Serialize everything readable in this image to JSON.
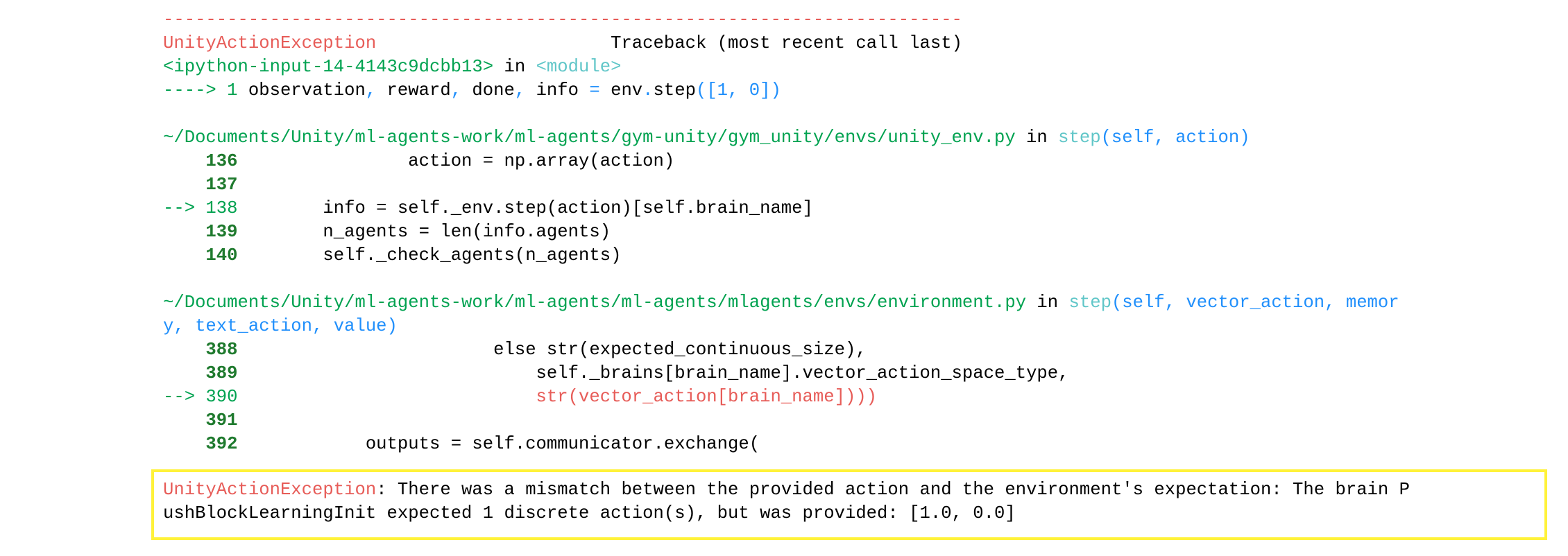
{
  "traceback": {
    "separator": "---------------------------------------------------------------------------",
    "exception_name": "UnityActionException",
    "header_gap": "                      ",
    "header_right": "Traceback (most recent call last)",
    "frame1": {
      "location": "<ipython-input-14-4143c9dcbb13>",
      "in_word": " in ",
      "module": "<module>",
      "arrow": "----> 1",
      "code_a": " observation",
      "comma1": ",",
      "code_b": " reward",
      "comma2": ",",
      "code_c": " done",
      "comma3": ",",
      "code_d": " info ",
      "eq": "=",
      "code_e": " env",
      "dot": ".",
      "code_f": "step",
      "args": "([1, 0])"
    },
    "frame2": {
      "path": "~/Documents/Unity/ml-agents-work/ml-agents/gym-unity/gym_unity/envs/unity_env.py",
      "in_word": " in ",
      "func": "step",
      "signature": "(self, action)",
      "lines": [
        {
          "num": "    136",
          "code": "                action = np.array(action)"
        },
        {
          "num": "    137",
          "code": ""
        },
        {
          "num": "--> 138",
          "code": "        info = self._env.step(action)[self.brain_name]"
        },
        {
          "num": "    139",
          "code": "        n_agents = len(info.agents)"
        },
        {
          "num": "    140",
          "code": "        self._check_agents(n_agents)"
        }
      ]
    },
    "frame3": {
      "path": "~/Documents/Unity/ml-agents-work/ml-agents/ml-agents/mlagents/envs/environment.py",
      "in_word": " in ",
      "func": "step",
      "signature_a": "(self, vector_action, memor",
      "signature_b": "y, text_action, value)",
      "lines": [
        {
          "num": "    388",
          "code": "                        else str(expected_continuous_size),"
        },
        {
          "num": "    389",
          "code": "                            self._brains[brain_name].vector_action_space_type,"
        },
        {
          "num": "--> 390",
          "code": "                            str(vector_action[brain_name])))"
        },
        {
          "num": "    391",
          "code": ""
        },
        {
          "num": "    392",
          "code": "            outputs = self.communicator.exchange("
        }
      ]
    }
  },
  "error": {
    "name": "UnityActionException",
    "message_line1": ": There was a mismatch between the provided action and the environment's expectation: The brain P",
    "message_line2": "ushBlockLearningInit expected 1 discrete action(s), but was provided: [1.0, 0.0]"
  },
  "colors": {
    "error_red": "#e75c58",
    "path_green": "#00a250",
    "line_number_green": "#1f7a2e",
    "func_cyan": "#60c6c8",
    "blue": "#208ffb",
    "highlight_yellow": "#fff23a"
  }
}
